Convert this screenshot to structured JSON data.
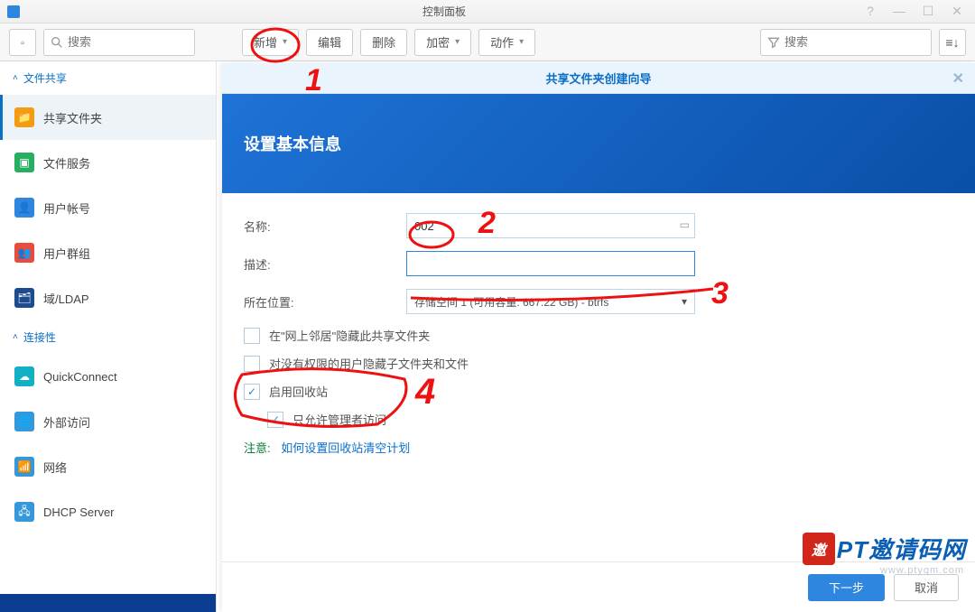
{
  "window": {
    "title": "控制面板"
  },
  "toolbar": {
    "search_left_placeholder": "搜索",
    "add": "新增",
    "edit": "编辑",
    "delete": "删除",
    "encrypt": "加密",
    "action": "动作",
    "search_right_placeholder": "搜索"
  },
  "sidebar": {
    "section1": "文件共享",
    "section2": "连接性",
    "items": [
      {
        "label": "共享文件夹"
      },
      {
        "label": "文件服务"
      },
      {
        "label": "用户帐号"
      },
      {
        "label": "用户群组"
      },
      {
        "label": "域/LDAP"
      },
      {
        "label": "QuickConnect"
      },
      {
        "label": "外部访问"
      },
      {
        "label": "网络"
      },
      {
        "label": "DHCP Server"
      }
    ]
  },
  "modal": {
    "title": "共享文件夹创建向导",
    "banner": "设置基本信息",
    "name_label": "名称:",
    "name_value": "002",
    "desc_label": "描述:",
    "desc_value": "",
    "loc_label": "所在位置:",
    "loc_value": "存储空间 1 (可用容量: 667.22 GB) - btrfs",
    "chk_hide_network": "在\"网上邻居\"隐藏此共享文件夹",
    "chk_hide_noperm": "对没有权限的用户隐藏子文件夹和文件",
    "chk_recycle": "启用回收站",
    "chk_admin_only": "只允许管理者访问",
    "note_prefix": "注意:",
    "note_link": "如何设置回收站清空计划",
    "btn_next": "下一步",
    "btn_cancel": "取消"
  },
  "watermark": {
    "badge": "邀",
    "text": "PT邀请码网",
    "sub": "www.ptyqm.com"
  },
  "annotations": {
    "n1": "1",
    "n2": "2",
    "n3": "3",
    "n4": "4"
  }
}
